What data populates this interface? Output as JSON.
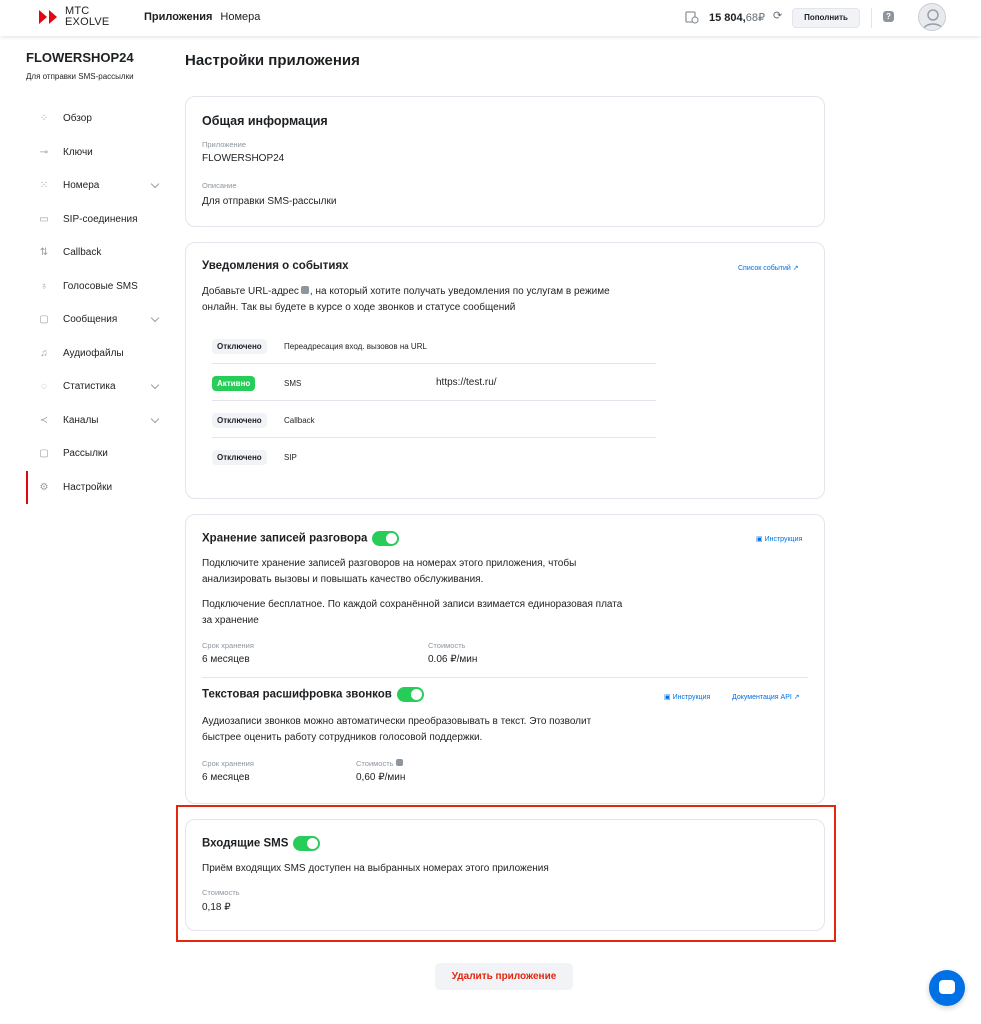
{
  "header": {
    "logo_line1": "МТС",
    "logo_line2": "EXOLVE",
    "nav": [
      "Приложения",
      "Номера"
    ],
    "balance_main": "15 804,",
    "balance_dec": "68₽",
    "topup_label": "Пополнить"
  },
  "app": {
    "name": "FLOWERSHOP24",
    "subtitle": "Для отправки SMS-рассылки"
  },
  "sidebar": {
    "items": [
      {
        "label": "Обзор",
        "icon": "overview-icon"
      },
      {
        "label": "Ключи",
        "icon": "key-icon"
      },
      {
        "label": "Номера",
        "icon": "dialpad-icon",
        "expand": true
      },
      {
        "label": "SIP-соединения",
        "icon": "sip-icon"
      },
      {
        "label": "Callback",
        "icon": "callback-icon"
      },
      {
        "label": "Голосовые SMS",
        "icon": "microphone-icon"
      },
      {
        "label": "Сообщения",
        "icon": "message-icon",
        "expand": true
      },
      {
        "label": "Аудиофайлы",
        "icon": "music-icon"
      },
      {
        "label": "Статистика",
        "icon": "chart-icon",
        "expand": true
      },
      {
        "label": "Каналы",
        "icon": "share-icon",
        "expand": true
      },
      {
        "label": "Рассылки",
        "icon": "mailing-icon"
      },
      {
        "label": "Настройки",
        "icon": "gear-icon",
        "active": true
      }
    ]
  },
  "page_title": "Настройки приложения",
  "general": {
    "title": "Общая информация",
    "app_label": "Приложение",
    "app_value": "FLOWERSHOP24",
    "desc_label": "Описание",
    "desc_value": "Для отправки SMS-рассылки"
  },
  "notifications": {
    "title": "Уведомления о событиях",
    "link": "Список событий",
    "text1": "Добавьте URL-адрес",
    "text2": ", на который хотите получать уведомления по услугам в режиме",
    "text3": "онлайн. Так вы будете в курсе о ходе звонков и статусе сообщений",
    "rows": [
      {
        "status": "Отключено",
        "name": "Переадресация вход. вызовов на URL",
        "url": ""
      },
      {
        "status": "Активно",
        "name": "SMS",
        "url": "https://test.ru/"
      },
      {
        "status": "Отключено",
        "name": "Callback",
        "url": ""
      },
      {
        "status": "Отключено",
        "name": "SIP",
        "url": ""
      }
    ]
  },
  "recording": {
    "title": "Хранение записей разговора",
    "link": "Инструкция",
    "text1": "Подключите хранение записей разговоров на номерах этого приложения, чтобы",
    "text2": "анализировать вызовы и повышать качество обслуживания.",
    "text3": "Подключение бесплатное. По каждой сохранённой записи взимается единоразовая плата",
    "text4": "за хранение",
    "period_label": "Срок хранения",
    "period_value": "6 месяцев",
    "cost_label": "Стоимость",
    "cost_value": "0.06 ₽/мин",
    "enabled": true
  },
  "transcription": {
    "title": "Текстовая расшифровка звонков",
    "link1": "Инструкция",
    "link2": "Документация API",
    "text1": "Аудиозаписи звонков можно автоматически преобразовывать в текст. Это позволит",
    "text2": "быстрее оценить работу сотрудников голосовой поддержки.",
    "period_label": "Срок хранения",
    "period_value": "6 месяцев",
    "cost_label": "Стоимость",
    "cost_value": "0,60 ₽/мин",
    "enabled": true
  },
  "incoming_sms": {
    "title": "Входящие SMS",
    "text": "Приём входящих SMS доступен на выбранных номерах этого приложения",
    "cost_label": "Стоимость",
    "cost_value": "0,18 ₽",
    "enabled": true
  },
  "delete_label": "Удалить приложение",
  "colors": {
    "accent": "#e30611",
    "toggle": "#26cd58",
    "link": "#0070e5",
    "danger": "#e3260e"
  }
}
